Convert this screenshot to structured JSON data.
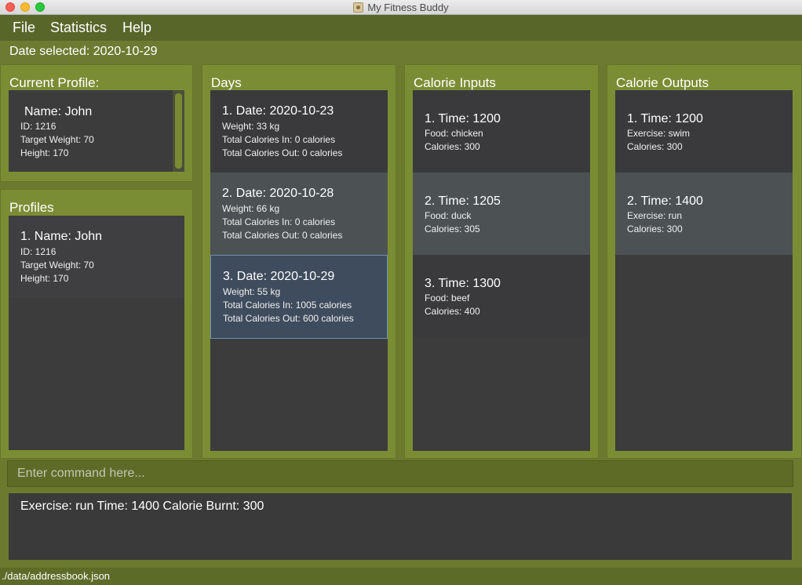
{
  "window": {
    "title": "My Fitness Buddy"
  },
  "menu": {
    "file": "File",
    "statistics": "Statistics",
    "help": "Help"
  },
  "date_selected": "Date selected: 2020-10-29",
  "current_profile": {
    "title": "Current Profile:",
    "name": "Name: John",
    "id": "ID: 1216",
    "target": "Target Weight: 70",
    "height": "Height: 170"
  },
  "profiles": {
    "title": "Profiles",
    "items": [
      {
        "head": "1.  Name: John",
        "id": "ID: 1216",
        "target": "Target Weight: 70",
        "height": "Height: 170"
      }
    ]
  },
  "days": {
    "title": "Days",
    "items": [
      {
        "head": "1.  Date: 2020-10-23",
        "weight": "Weight: 33 kg",
        "cin": "Total Calories In: 0 calories",
        "cout": "Total Calories Out: 0 calories"
      },
      {
        "head": "2.  Date: 2020-10-28",
        "weight": "Weight: 66 kg",
        "cin": "Total Calories In: 0 calories",
        "cout": "Total Calories Out: 0 calories"
      },
      {
        "head": "3.  Date: 2020-10-29",
        "weight": "Weight: 55 kg",
        "cin": "Total Calories In: 1005 calories",
        "cout": "Total Calories Out: 600 calories"
      }
    ]
  },
  "calorie_inputs": {
    "title": "Calorie Inputs",
    "items": [
      {
        "head": "1.  Time: 1200",
        "food": "Food: chicken",
        "cal": "Calories: 300"
      },
      {
        "head": "2.  Time: 1205",
        "food": "Food: duck",
        "cal": "Calories: 305"
      },
      {
        "head": "3.  Time: 1300",
        "food": "Food: beef",
        "cal": "Calories: 400"
      }
    ]
  },
  "calorie_outputs": {
    "title": "Calorie Outputs",
    "items": [
      {
        "head": "1.  Time: 1200",
        "exercise": "Exercise: swim",
        "cal": "Calories: 300"
      },
      {
        "head": "2.  Time: 1400",
        "exercise": "Exercise: run",
        "cal": "Calories: 300"
      }
    ]
  },
  "command": {
    "placeholder": "Enter command here..."
  },
  "result": "Exercise: run Time: 1400 Calorie Burnt: 300",
  "status": "./data/addressbook.json"
}
